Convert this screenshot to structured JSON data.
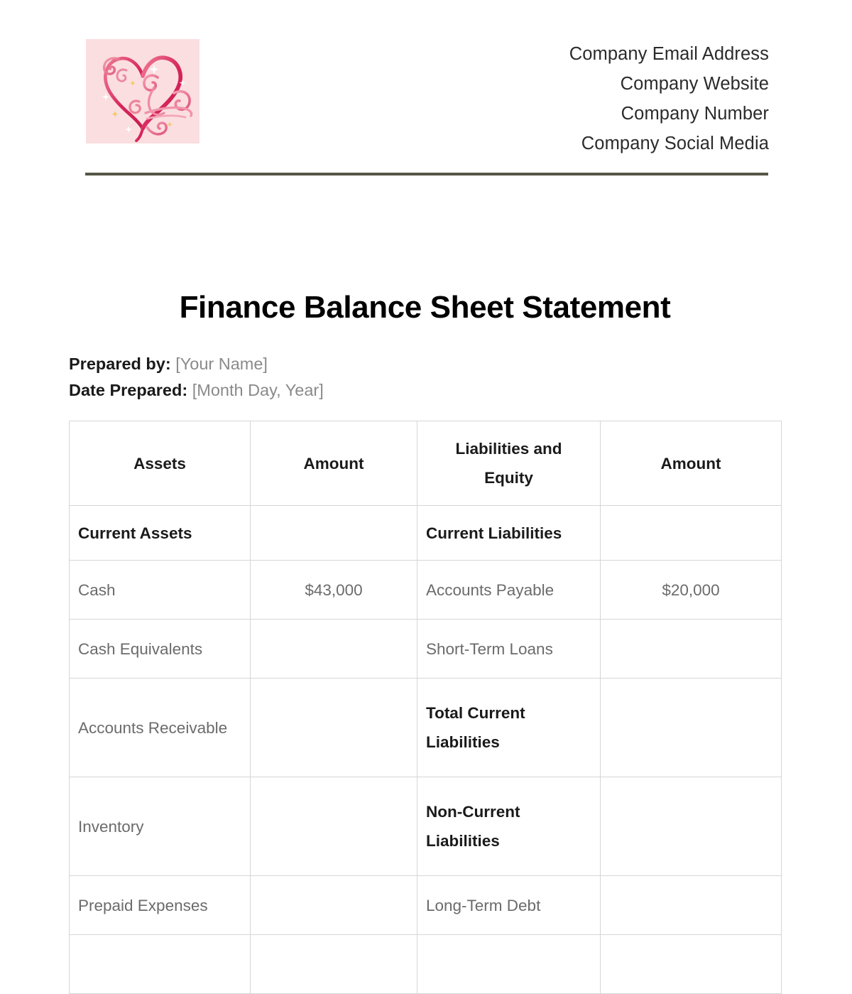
{
  "letterhead": {
    "logo": {
      "icon_name": "ornate-heart-logo",
      "background_color": "#fbdee0",
      "accent_color": "#d6255b",
      "secondary_color": "#ef7b94",
      "sparkle_color": "#f2c75c"
    },
    "contact_lines": [
      "Company Email Address",
      "Company Website",
      "Company Number",
      "Company Social Media"
    ],
    "divider_color": "#565648"
  },
  "document": {
    "title": "Finance Balance Sheet Statement",
    "prepared_by_label": "Prepared by:",
    "prepared_by_value": "[Your Name]",
    "date_prepared_label": "Date Prepared:",
    "date_prepared_value": "[Month Day, Year]"
  },
  "table": {
    "headers": [
      "Assets",
      "Amount",
      "Liabilities and Equity",
      "Amount"
    ],
    "rows": [
      {
        "type": "section",
        "assets": "Current Assets",
        "assets_amount": "",
        "liabilities": "Current Liabilities",
        "liabilities_amount": "",
        "assets_bold": true,
        "liabilities_bold": true
      },
      {
        "type": "normal",
        "assets": "Cash",
        "assets_amount": "$43,000",
        "liabilities": "Accounts Payable",
        "liabilities_amount": "$20,000",
        "assets_bold": false,
        "liabilities_bold": false
      },
      {
        "type": "normal",
        "assets": "Cash Equivalents",
        "assets_amount": "",
        "liabilities": "Short-Term Loans",
        "liabilities_amount": "",
        "assets_bold": false,
        "liabilities_bold": false
      },
      {
        "type": "tall",
        "assets": "Accounts Receivable",
        "assets_amount": "",
        "liabilities": "Total Current Liabilities",
        "liabilities_amount": "",
        "assets_bold": false,
        "liabilities_bold": true
      },
      {
        "type": "tall",
        "assets": "Inventory",
        "assets_amount": "",
        "liabilities": "Non-Current Liabilities",
        "liabilities_amount": "",
        "assets_bold": false,
        "liabilities_bold": true
      },
      {
        "type": "normal",
        "assets": "Prepaid Expenses",
        "assets_amount": "",
        "liabilities": "Long-Term Debt",
        "liabilities_amount": "",
        "assets_bold": false,
        "liabilities_bold": false
      },
      {
        "type": "normal",
        "assets": "",
        "assets_amount": "",
        "liabilities": "",
        "liabilities_amount": "",
        "assets_bold": false,
        "liabilities_bold": false
      }
    ]
  }
}
